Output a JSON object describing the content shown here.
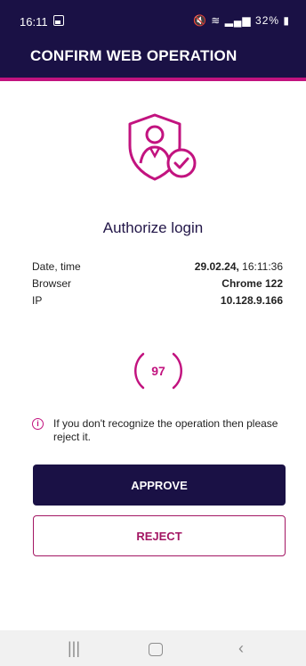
{
  "status_bar": {
    "time": "16:11",
    "battery": "32%"
  },
  "header": {
    "title": "CONFIRM WEB OPERATION"
  },
  "main": {
    "title": "Authorize login",
    "details": [
      {
        "label": "Date, time",
        "value_bold": "29.02.24,",
        "value_rest": " 16:11:36"
      },
      {
        "label": "Browser",
        "value": "Chrome 122"
      },
      {
        "label": "IP",
        "value": "10.128.9.166"
      }
    ],
    "countdown": "97",
    "info_text": "If you don't recognize the operation then please reject it.",
    "approve_label": "APPROVE",
    "reject_label": "REJECT"
  },
  "icons": [
    "image-icon",
    "silent-icon",
    "wifi-icon",
    "signal-icon",
    "battery-icon",
    "shield-user-icon",
    "info-icon",
    "recent-apps-icon",
    "home-icon",
    "back-icon"
  ],
  "colors": {
    "primary": "#1a1145",
    "accent": "#c2137f"
  }
}
